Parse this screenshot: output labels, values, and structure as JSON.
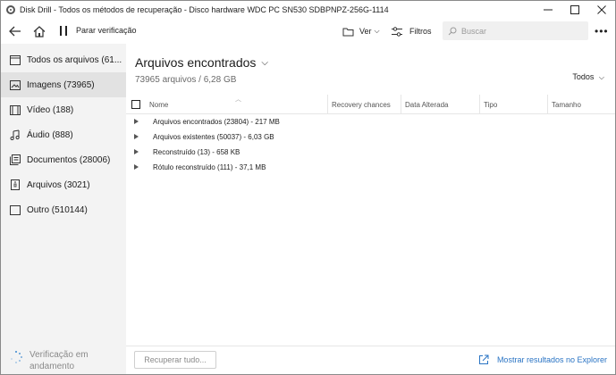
{
  "window": {
    "title": "Disk Drill - Todos os métodos de recuperação - Disco hardware WDC PC SN530 SDBPNPZ-256G-1114",
    "controls": [
      "minimize-icon",
      "maximize-icon",
      "close-icon"
    ]
  },
  "toolbar": {
    "pause_label": "Parar verificação",
    "view_label": "Ver",
    "filter_label": "Filtros",
    "search_placeholder": "Buscar"
  },
  "sidebar": {
    "items": [
      {
        "label": "Todos os arquivos (61...",
        "icon": "folder-icon",
        "active": false
      },
      {
        "label": "Imagens (73965)",
        "icon": "image-icon",
        "active": true
      },
      {
        "label": "Vídeo (188)",
        "icon": "video-icon",
        "active": false
      },
      {
        "label": "Áudio (888)",
        "icon": "music-note-icon",
        "active": false
      },
      {
        "label": "Documentos (28006)",
        "icon": "document-icon",
        "active": false
      },
      {
        "label": "Arquivos (3021)",
        "icon": "archive-icon",
        "active": false
      },
      {
        "label": "Outro (510144)",
        "icon": "other-file-icon",
        "active": false
      }
    ],
    "status": {
      "line1": "Verificação em",
      "line2": "andamento"
    }
  },
  "main": {
    "title": "Arquivos encontrados",
    "subtitle": "73965 arquivos / 6,28 GB",
    "filter_label": "Todos",
    "columns": [
      "Nome",
      "Recovery chances",
      "Data Alterada",
      "Tipo",
      "Tamanho"
    ],
    "rows": [
      {
        "label": "Arquivos encontrados (23804) - 217 MB"
      },
      {
        "label": "Arquivos existentes (50037) - 6,03 GB"
      },
      {
        "label": "Reconstruído (13) - 658 KB"
      },
      {
        "label": "Rótulo reconstruído (111) - 37,1 MB"
      }
    ]
  },
  "footer": {
    "recover_label": "Recuperar tudo...",
    "explorer_label": "Mostrar resultados no Explorer"
  },
  "colors": {
    "accent": "#2a74c4",
    "sidebar_bg": "#f3f3f3",
    "sidebar_active": "#e2e2e2",
    "spinner": "#3a88d0"
  }
}
